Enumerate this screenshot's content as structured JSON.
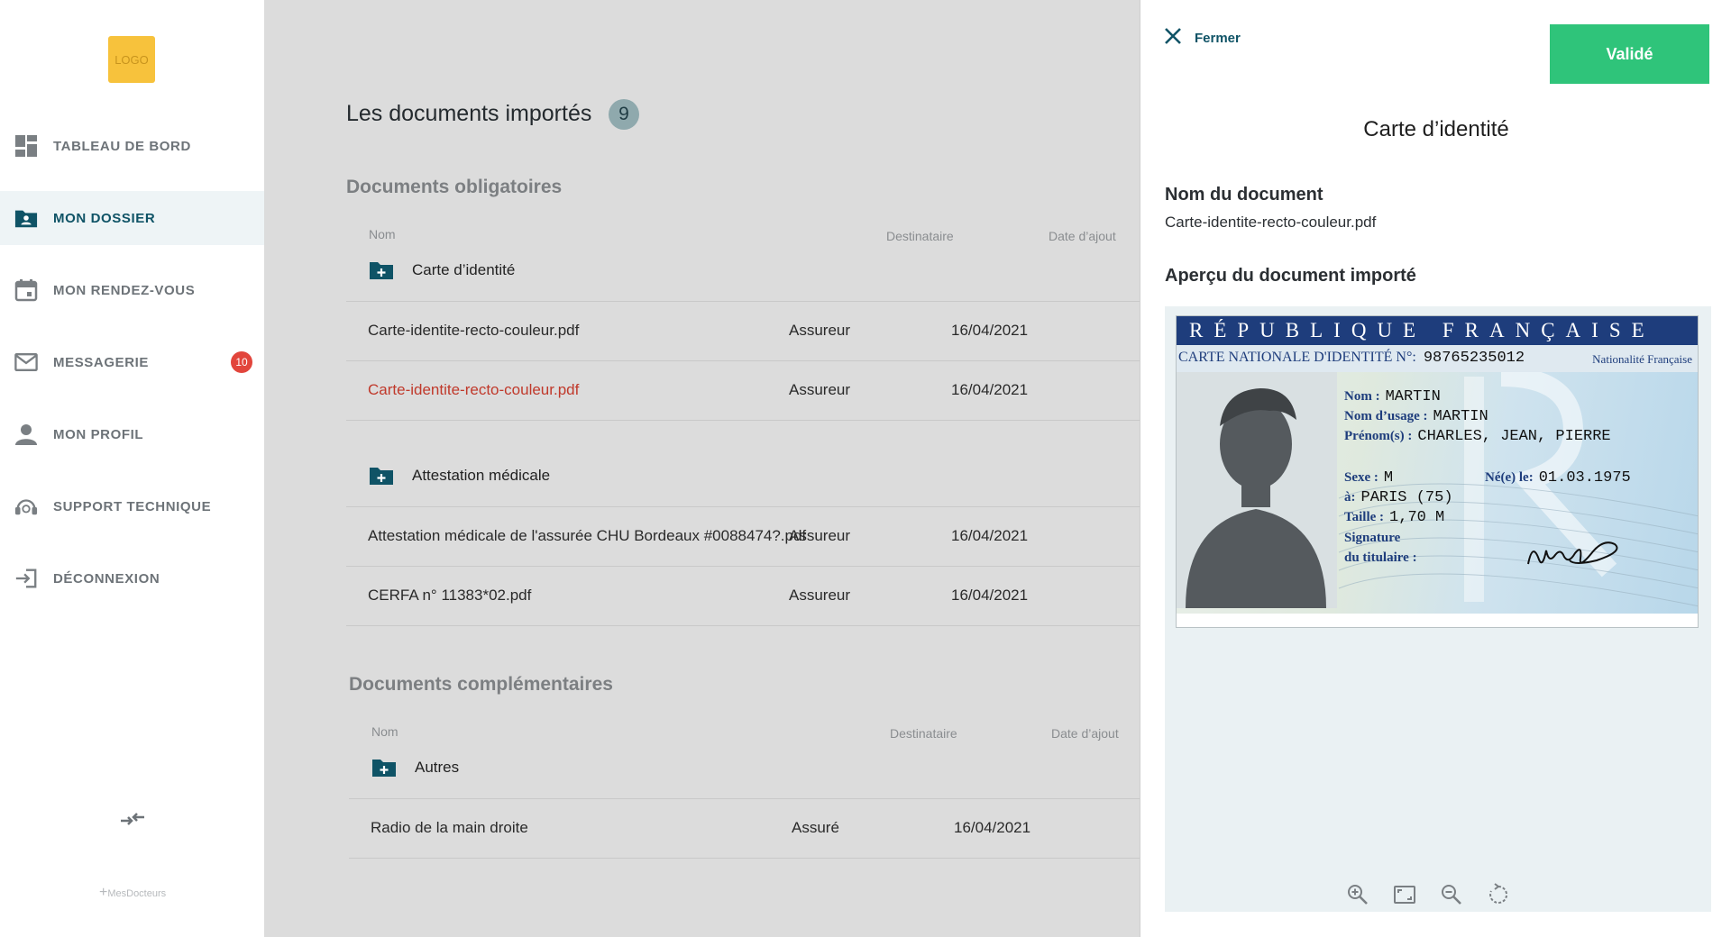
{
  "sidebar": {
    "logo": "LOGO",
    "items": [
      {
        "label": "TABLEAU DE BORD",
        "icon": "dashboard-icon"
      },
      {
        "label": "MON DOSSIER",
        "icon": "folder-user-icon"
      },
      {
        "label": "MON RENDEZ-VOUS",
        "icon": "calendar-icon"
      },
      {
        "label": "MESSAGERIE",
        "icon": "mail-icon",
        "badge": "10"
      },
      {
        "label": "MON PROFIL",
        "icon": "user-icon"
      },
      {
        "label": "SUPPORT TECHNIQUE",
        "icon": "support-icon"
      },
      {
        "label": "DÉCONNEXION",
        "icon": "logout-icon"
      }
    ],
    "brand": "MesDocteurs"
  },
  "main": {
    "title": "Les documents importés",
    "count": "9",
    "mandatory": {
      "title": "Documents obligatoires",
      "columns": [
        "Nom",
        "Destinataire",
        "Date d’ajout"
      ],
      "groups": [
        {
          "name": "Carte d’identité",
          "rows": [
            {
              "name": "Carte-identite-recto-couleur.pdf",
              "to": "Assureur",
              "date": "16/04/2021"
            },
            {
              "name": "Carte-identite-recto-couleur.pdf",
              "to": "Assureur",
              "date": "16/04/2021"
            }
          ]
        },
        {
          "name": "Attestation médicale",
          "rows": [
            {
              "name": "Attestation médicale de l'assurée CHU Bordeaux #0088474?.pdf",
              "to": "Assureur",
              "date": "16/04/2021"
            },
            {
              "name": "CERFA n° 11383*02.pdf",
              "to": "Assureur",
              "date": "16/04/2021"
            }
          ]
        }
      ]
    },
    "complementary": {
      "title": "Documents complémentaires",
      "columns": [
        "Nom",
        "Destinataire",
        "Date d’ajout"
      ],
      "groups": [
        {
          "name": "Autres",
          "rows": [
            {
              "name": "Radio de la main droite",
              "to": "Assuré",
              "date": "16/04/2021"
            }
          ]
        }
      ]
    }
  },
  "panel": {
    "close_label": "Fermer",
    "validate_label": "Validé",
    "title": "Carte d’identité",
    "doc_name_label": "Nom du document",
    "doc_name_value": "Carte-identite-recto-couleur.pdf",
    "preview_label": "Aperçu du document importé",
    "card": {
      "header": "RÉPUBLIQUE FRANÇAISE",
      "number_label": "CARTE NATIONALE D'IDENTITÉ N°:",
      "number": "98765235012",
      "nationality": "Nationalité Française",
      "nom_label": "Nom :",
      "nom": "MARTIN",
      "usage_label": "Nom d’usage :",
      "usage": "MARTIN",
      "prenoms_label": "Prénom(s) :",
      "prenoms": "CHARLES, JEAN, PIERRE",
      "sexe_label": "Sexe :",
      "sexe": "M",
      "ne_label": "Né(e) le:",
      "ne": "01.03.1975",
      "lieu_label": "à:",
      "lieu": "PARIS (75)",
      "taille_label": "Taille :",
      "taille": "1,70 M",
      "signature_label_1": "Signature",
      "signature_label_2": "du titulaire :"
    },
    "tools": [
      "zoom-in-icon",
      "fit-screen-icon",
      "zoom-out-icon",
      "rotate-icon"
    ]
  }
}
